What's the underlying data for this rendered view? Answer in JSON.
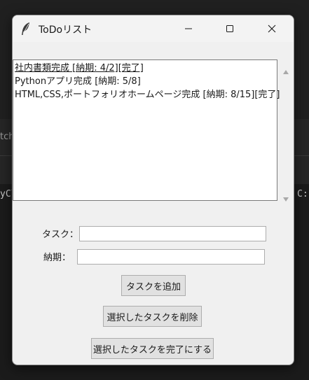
{
  "background": {
    "left_top_fragment": "tch",
    "left_fragment": "yCl",
    "right_fragment": "C:"
  },
  "window": {
    "title": "ToDoリスト",
    "icon": "feather-icon",
    "controls": {
      "minimize": "minimize-icon",
      "maximize": "maximize-icon",
      "close": "close-icon"
    }
  },
  "tasks": [
    "社内書類完成 [納期: 4/2][完了]",
    "Pythonアプリ完成 [納期: 5/8]",
    "HTML,CSS,ポートフォリオホームページ完成 [納期: 8/15][完了]"
  ],
  "form": {
    "task_label": "タスク：",
    "task_value": "",
    "due_label": "納期：",
    "due_value": ""
  },
  "buttons": {
    "add": "タスクを追加",
    "delete": "選択したタスクを削除",
    "complete": "選択したタスクを完了にする"
  }
}
